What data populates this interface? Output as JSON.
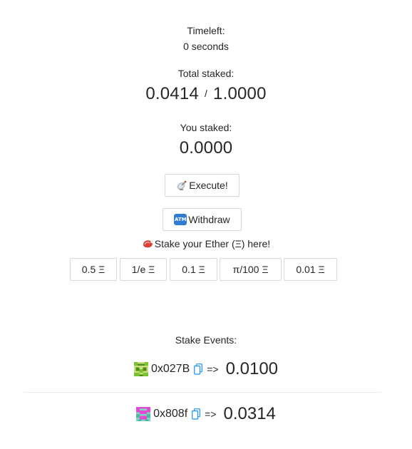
{
  "timeleft": {
    "label": "Timeleft:",
    "value": "0 seconds"
  },
  "total_staked": {
    "label": "Total staked:",
    "current": "0.0414",
    "separator": "/",
    "threshold": "1.0000"
  },
  "you_staked": {
    "label": "You staked:",
    "value": "0.0000"
  },
  "actions": {
    "execute_label": "Execute!",
    "withdraw_label": "Withdraw",
    "atm_icon_text": "ATM"
  },
  "stake_prompt": "Stake your Ether (Ξ) here!",
  "amount_buttons": [
    "0.5 Ξ",
    "1/e Ξ",
    "0.1 Ξ",
    "π/100 Ξ",
    "0.01 Ξ"
  ],
  "events": {
    "title": "Stake Events:",
    "items": [
      {
        "address": "0x027B",
        "arrow": "=>",
        "amount": "0.0100",
        "avatar_color": "#7ac231"
      },
      {
        "address": "0x808f",
        "arrow": "=>",
        "amount": "0.0314",
        "avatar_color": "#e14bd1"
      }
    ]
  },
  "colors": {
    "text": "#262626",
    "border": "#d9d9d9",
    "copy_icon": "#1890ff",
    "atm_blue": "#2f7bd6"
  },
  "icons": [
    "satellite-icon",
    "atm-icon",
    "meat-icon",
    "copy-icon",
    "blockie-avatar-icon"
  ]
}
